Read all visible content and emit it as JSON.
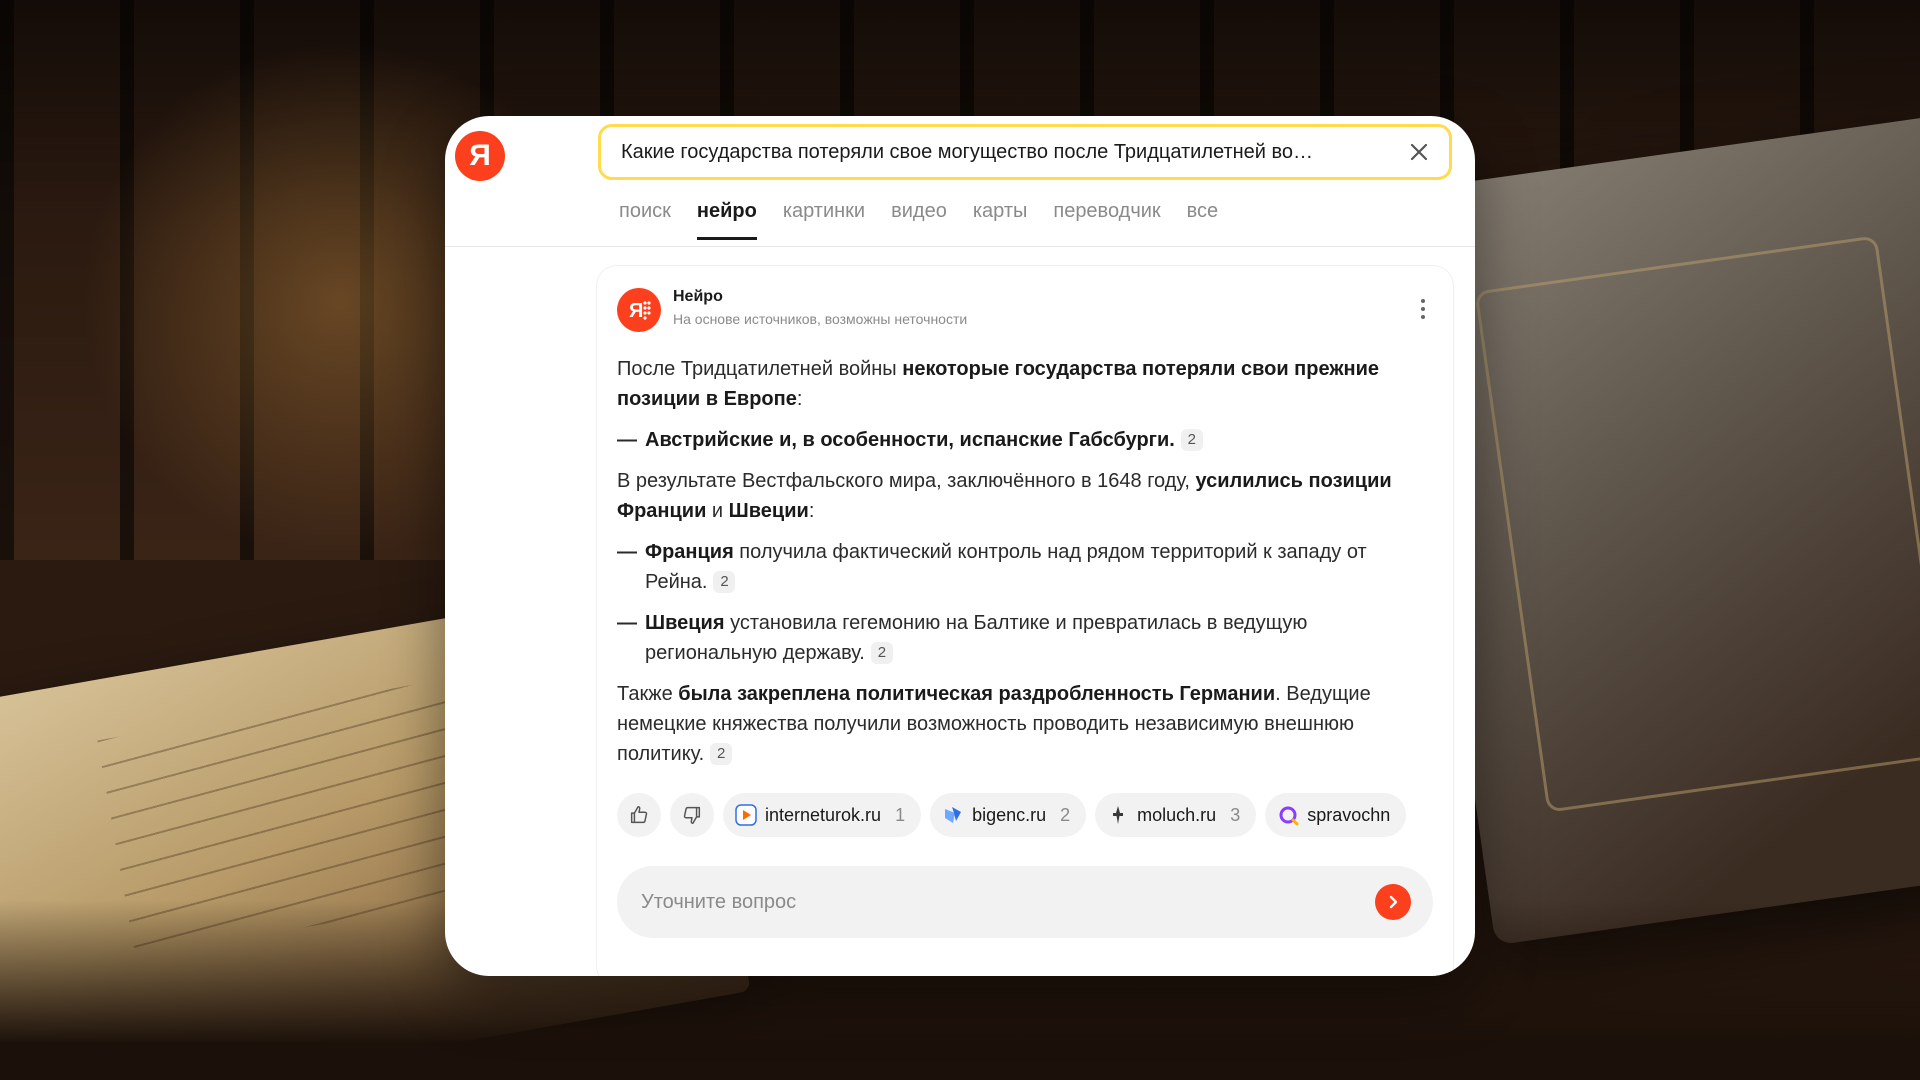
{
  "header": {
    "logo_letter": "Я",
    "search_query": "Какие государства потеряли свое могущество после Тридцатилетней во…"
  },
  "tabs": [
    {
      "label": "поиск",
      "active": false
    },
    {
      "label": "нейро",
      "active": true
    },
    {
      "label": "картинки",
      "active": false
    },
    {
      "label": "видео",
      "active": false
    },
    {
      "label": "карты",
      "active": false
    },
    {
      "label": "переводчик",
      "active": false
    },
    {
      "label": "все",
      "active": false
    }
  ],
  "answer": {
    "title": "Нейро",
    "subtitle": "На основе источников, возможны неточности",
    "p1": {
      "a": "После Тридцатилетней войны ",
      "b": "некоторые государства потеряли свои прежние позиции в Европе",
      "c": ":"
    },
    "li1": {
      "dash": "—",
      "b": "Австрийские и, в особенности, испанские Габсбурги.",
      "cite": "2"
    },
    "p2": {
      "a": "В результате Вестфальского мира, заключённого в 1648 году, ",
      "b1": "усилились позиции Франции",
      "mid": " и ",
      "b2": "Швеции",
      "c": ":"
    },
    "li2": {
      "dash": "—",
      "b": "Франция",
      "text": " получила фактический контроль над рядом территорий к западу от Рейна.",
      "cite": "2"
    },
    "li3": {
      "dash": "—",
      "b": "Швеция",
      "text": " установила гегемонию на Балтике и превратилась в ведущую региональную державу.",
      "cite": "2"
    },
    "p3": {
      "a": "Также ",
      "b": "была закреплена политическая раздробленность Германии",
      "c": ". Ведущие немецкие княжества получили возможность проводить независимую внешнюю политику.",
      "cite": "2"
    }
  },
  "sources": [
    {
      "name": "interneturok.ru",
      "num": "1",
      "icon": "play-icon",
      "color": "#ff6a00"
    },
    {
      "name": "bigenc.ru",
      "num": "2",
      "icon": "bigenc-icon",
      "color": "#2f6fe8"
    },
    {
      "name": "moluch.ru",
      "num": "3",
      "icon": "moluch-icon",
      "color": "#3a3a3a"
    },
    {
      "name": "spravochn",
      "num": "",
      "icon": "spravochnik-icon",
      "color": "#8b3dff"
    }
  ],
  "followup": {
    "placeholder": "Уточните вопрос"
  },
  "colors": {
    "brand": "#fc3f1d",
    "search_border": "#ffdb4d"
  }
}
